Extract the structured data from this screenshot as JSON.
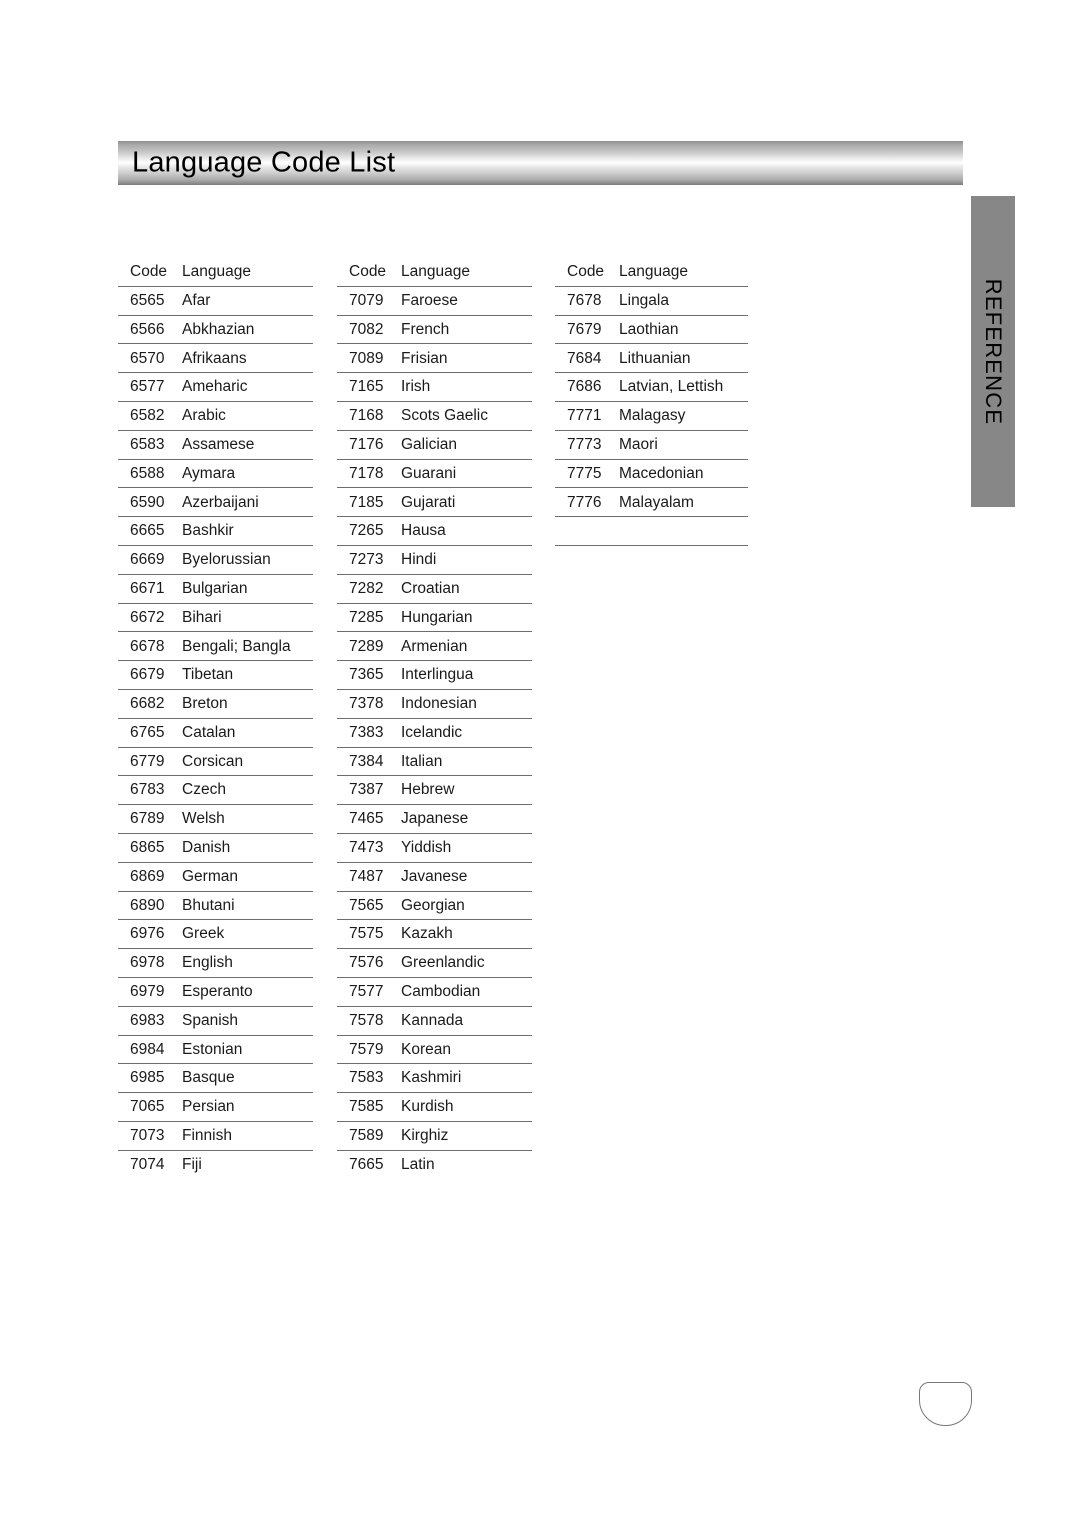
{
  "document": {
    "title": "Language Code List",
    "side_tab_label": "REFERENCE",
    "page_number": ""
  },
  "table": {
    "headers": {
      "code": "Code",
      "language": "Language"
    },
    "columns": [
      {
        "rows": [
          {
            "code": "6565",
            "language": "Afar"
          },
          {
            "code": "6566",
            "language": "Abkhazian"
          },
          {
            "code": "6570",
            "language": "Afrikaans"
          },
          {
            "code": "6577",
            "language": "Ameharic"
          },
          {
            "code": "6582",
            "language": "Arabic"
          },
          {
            "code": "6583",
            "language": "Assamese"
          },
          {
            "code": "6588",
            "language": "Aymara"
          },
          {
            "code": "6590",
            "language": "Azerbaijani"
          },
          {
            "code": "6665",
            "language": "Bashkir"
          },
          {
            "code": "6669",
            "language": "Byelorussian"
          },
          {
            "code": "6671",
            "language": "Bulgarian"
          },
          {
            "code": "6672",
            "language": "Bihari"
          },
          {
            "code": "6678",
            "language": "Bengali; Bangla"
          },
          {
            "code": "6679",
            "language": "Tibetan"
          },
          {
            "code": "6682",
            "language": "Breton"
          },
          {
            "code": "6765",
            "language": "Catalan"
          },
          {
            "code": "6779",
            "language": "Corsican"
          },
          {
            "code": "6783",
            "language": "Czech"
          },
          {
            "code": "6789",
            "language": "Welsh"
          },
          {
            "code": "6865",
            "language": "Danish"
          },
          {
            "code": "6869",
            "language": "German"
          },
          {
            "code": "6890",
            "language": "Bhutani"
          },
          {
            "code": "6976",
            "language": "Greek"
          },
          {
            "code": "6978",
            "language": "English"
          },
          {
            "code": "6979",
            "language": "Esperanto"
          },
          {
            "code": "6983",
            "language": "Spanish"
          },
          {
            "code": "6984",
            "language": "Estonian"
          },
          {
            "code": "6985",
            "language": "Basque"
          },
          {
            "code": "7065",
            "language": "Persian"
          },
          {
            "code": "7073",
            "language": "Finnish"
          },
          {
            "code": "7074",
            "language": "Fiji"
          }
        ]
      },
      {
        "rows": [
          {
            "code": "7079",
            "language": "Faroese"
          },
          {
            "code": "7082",
            "language": "French"
          },
          {
            "code": "7089",
            "language": "Frisian"
          },
          {
            "code": "7165",
            "language": "Irish"
          },
          {
            "code": "7168",
            "language": "Scots Gaelic"
          },
          {
            "code": "7176",
            "language": "Galician"
          },
          {
            "code": "7178",
            "language": "Guarani"
          },
          {
            "code": "7185",
            "language": "Gujarati"
          },
          {
            "code": "7265",
            "language": "Hausa"
          },
          {
            "code": "7273",
            "language": "Hindi"
          },
          {
            "code": "7282",
            "language": "Croatian"
          },
          {
            "code": "7285",
            "language": "Hungarian"
          },
          {
            "code": "7289",
            "language": "Armenian"
          },
          {
            "code": "7365",
            "language": "Interlingua"
          },
          {
            "code": "7378",
            "language": "Indonesian"
          },
          {
            "code": "7383",
            "language": "Icelandic"
          },
          {
            "code": "7384",
            "language": "Italian"
          },
          {
            "code": "7387",
            "language": "Hebrew"
          },
          {
            "code": "7465",
            "language": "Japanese"
          },
          {
            "code": "7473",
            "language": "Yiddish"
          },
          {
            "code": "7487",
            "language": "Javanese"
          },
          {
            "code": "7565",
            "language": "Georgian"
          },
          {
            "code": "7575",
            "language": "Kazakh"
          },
          {
            "code": "7576",
            "language": "Greenlandic"
          },
          {
            "code": "7577",
            "language": "Cambodian"
          },
          {
            "code": "7578",
            "language": "Kannada"
          },
          {
            "code": "7579",
            "language": "Korean"
          },
          {
            "code": "7583",
            "language": "Kashmiri"
          },
          {
            "code": "7585",
            "language": "Kurdish"
          },
          {
            "code": "7589",
            "language": "Kirghiz"
          },
          {
            "code": "7665",
            "language": "Latin"
          }
        ]
      },
      {
        "rows": [
          {
            "code": "7678",
            "language": "Lingala"
          },
          {
            "code": "7679",
            "language": "Laothian"
          },
          {
            "code": "7684",
            "language": "Lithuanian"
          },
          {
            "code": "7686",
            "language": "Latvian, Lettish"
          },
          {
            "code": "7771",
            "language": "Malagasy"
          },
          {
            "code": "7773",
            "language": "Maori"
          },
          {
            "code": "7775",
            "language": "Macedonian"
          },
          {
            "code": "7776",
            "language": "Malayalam"
          },
          {
            "code": "",
            "language": ""
          }
        ]
      }
    ]
  },
  "colors": {
    "side_tab_background": "#878787",
    "rule": "#6d6d6d",
    "text": "#1a1a1a"
  }
}
